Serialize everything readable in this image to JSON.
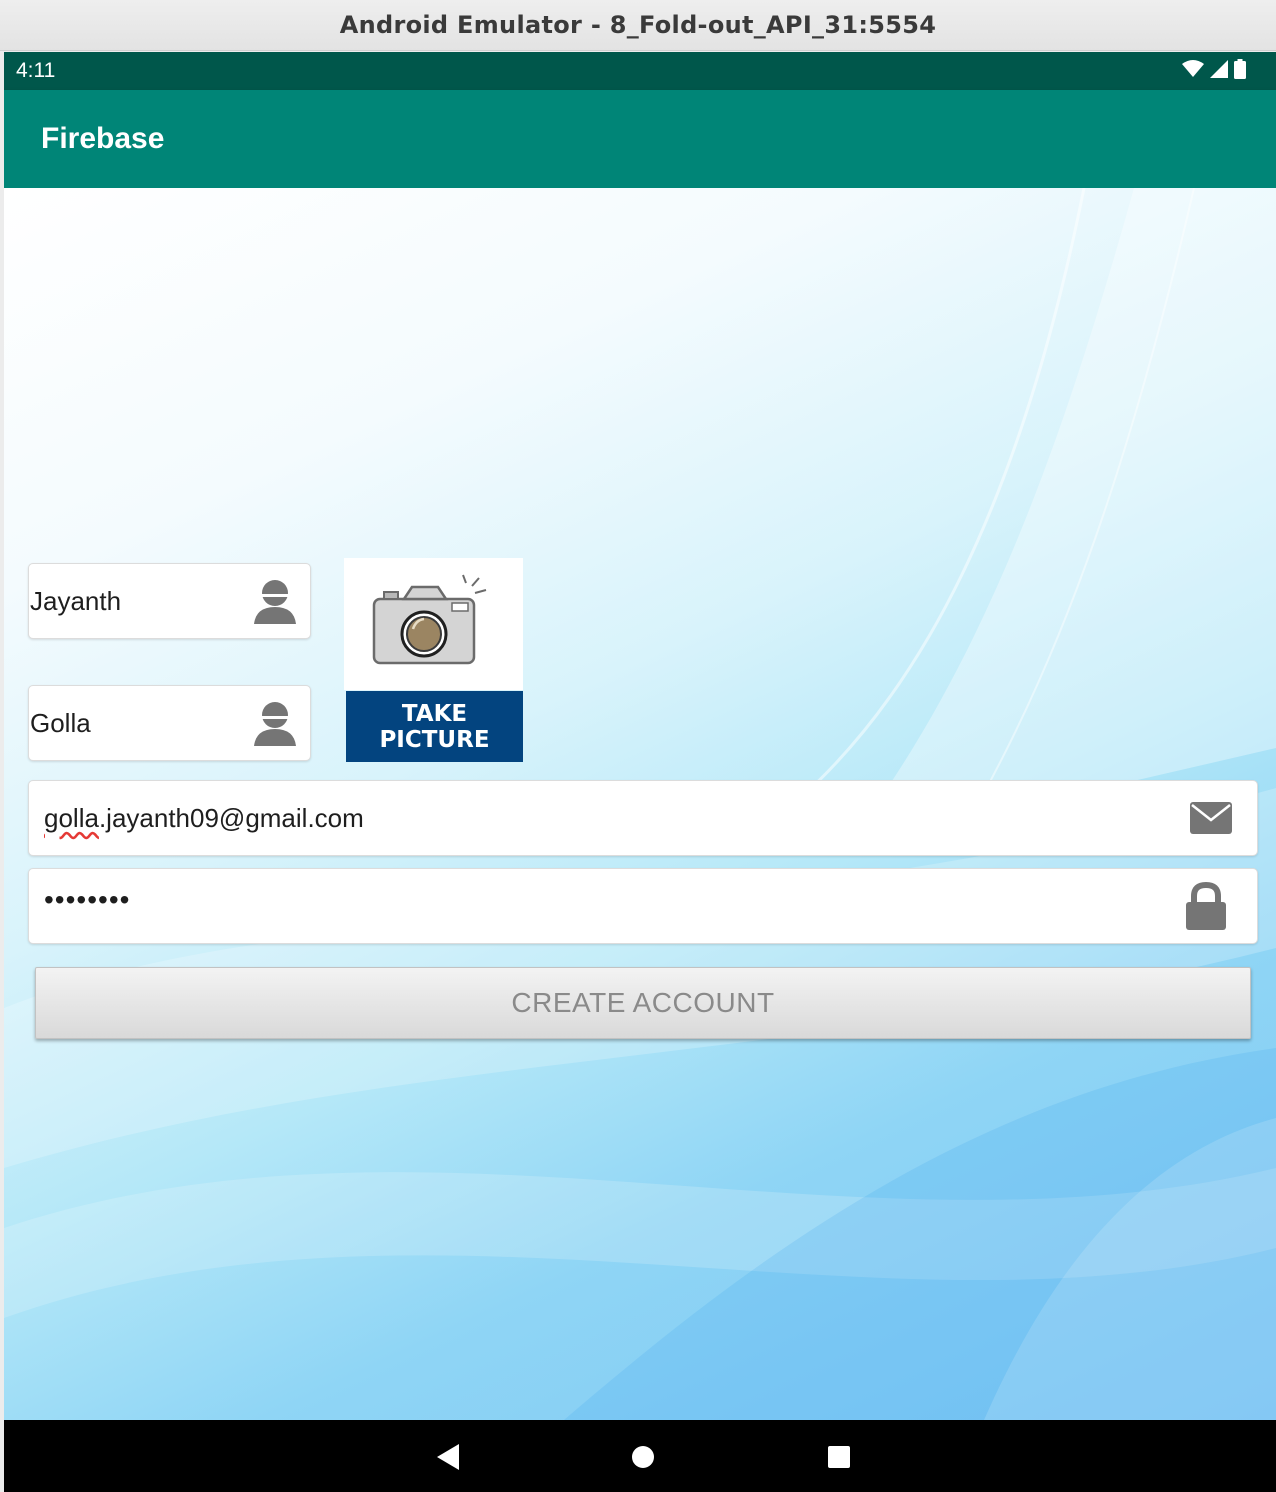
{
  "window": {
    "title": "Android Emulator - 8_Fold-out_API_31:5554"
  },
  "status_bar": {
    "time": "4:11",
    "icons": [
      "wifi-icon",
      "cell-signal-icon",
      "battery-icon"
    ]
  },
  "app_bar": {
    "title": "Firebase"
  },
  "form": {
    "first_name": {
      "value": "Jayanth",
      "icon": "person-icon"
    },
    "last_name": {
      "value": "Golla",
      "icon": "person-icon"
    },
    "email": {
      "value_misspelled": "golla",
      "value_rest": ".jayanth09@gmail.com",
      "icon": "envelope-icon"
    },
    "password": {
      "value": "••••••••",
      "icon": "lock-icon"
    },
    "camera": {
      "icon": "camera-icon",
      "button_label": "TAKE PICTURE"
    },
    "submit": {
      "label": "CREATE ACCOUNT"
    }
  },
  "nav_bar": {
    "buttons": [
      "back-icon",
      "home-icon",
      "recents-icon"
    ]
  },
  "colors": {
    "status_bar": "#00574b",
    "app_bar": "#008577",
    "take_picture_bg": "#03447f",
    "button_text": "#8a8a8a"
  }
}
